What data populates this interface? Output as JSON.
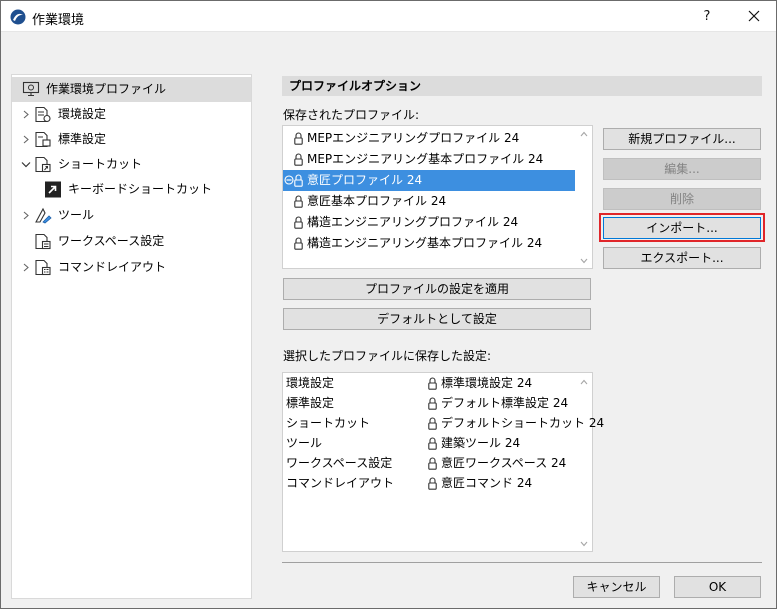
{
  "window": {
    "title": "作業環境",
    "help_label": "?"
  },
  "tree": {
    "items": [
      {
        "label": "作業環境プロファイル",
        "selected": true
      },
      {
        "label": "環境設定"
      },
      {
        "label": "標準設定"
      },
      {
        "label": "ショートカット"
      },
      {
        "label": "キーボードショートカット"
      },
      {
        "label": "ツール"
      },
      {
        "label": "ワークスペース設定"
      },
      {
        "label": "コマンドレイアウト"
      }
    ]
  },
  "main": {
    "section_title": "プロファイルオプション",
    "saved_profiles_label": "保存されたプロファイル:",
    "profiles": [
      {
        "label": "MEPエンジニアリングプロファイル 24"
      },
      {
        "label": "MEPエンジニアリング基本プロファイル 24"
      },
      {
        "label": "意匠プロファイル 24",
        "selected": true
      },
      {
        "label": "意匠基本プロファイル 24"
      },
      {
        "label": "構造エンジニアリングプロファイル 24"
      },
      {
        "label": "構造エンジニアリング基本プロファイル 24"
      }
    ],
    "buttons": {
      "new_profile": "新規プロファイル...",
      "edit": "編集...",
      "delete": "削除",
      "import": "インポート...",
      "export": "エクスポート...",
      "apply_settings": "プロファイルの設定を適用",
      "set_default": "デフォルトとして設定"
    },
    "saved_settings_label": "選択したプロファイルに保存した設定:",
    "settings": [
      {
        "category": "環境設定",
        "value": "標準環境設定 24"
      },
      {
        "category": "標準設定",
        "value": "デフォルト標準設定 24"
      },
      {
        "category": "ショートカット",
        "value": "デフォルトショートカット 24"
      },
      {
        "category": "ツール",
        "value": "建築ツール 24"
      },
      {
        "category": "ワークスペース設定",
        "value": "意匠ワークスペース 24"
      },
      {
        "category": "コマンドレイアウト",
        "value": "意匠コマンド 24"
      }
    ]
  },
  "footer": {
    "cancel": "キャンセル",
    "ok": "OK"
  },
  "colors": {
    "selection": "#3d8fe0",
    "highlight": "#e0262a",
    "tree_selected": "#dcdcdc"
  }
}
